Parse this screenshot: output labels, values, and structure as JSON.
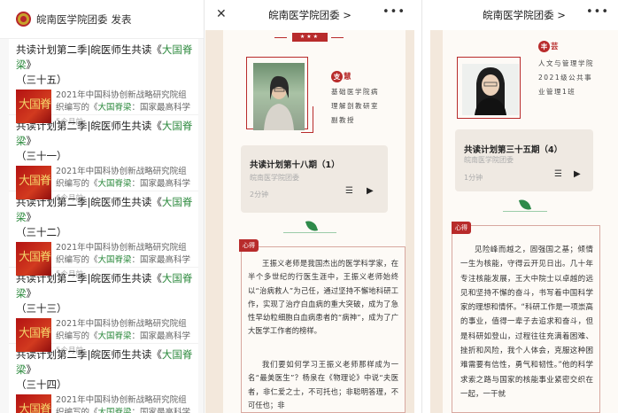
{
  "list": {
    "account": "皖南医学院团委",
    "publish": "发表",
    "items": [
      {
        "title_pre": "共读计划第二季|皖医师生共读《",
        "title_book": "大国脊梁",
        "title_post": "》",
        "title2": "（三十五）",
        "desc_pre": "2021年中国科协创新战略研究院组织编写的《",
        "desc_book": "大国脊梁",
        "desc_post": "：国家最高科学技术奖获...",
        "time": "5个月前",
        "thumb": "大国脊"
      },
      {
        "title_pre": "共读计划第二季|皖医师生共读《",
        "title_book": "大国脊梁",
        "title_post": "》",
        "title2": "（三十一）",
        "desc_pre": "2021年中国科协创新战略研究院组织编写的《",
        "desc_book": "大国脊梁",
        "desc_post": "：国家最高科学技术奖获...",
        "time": "6个月前",
        "thumb": "大国脊"
      },
      {
        "title_pre": "共读计划第二季|皖医师生共读《",
        "title_book": "大国脊梁",
        "title_post": "》",
        "title2": "（三十二）",
        "desc_pre": "2021年中国科协创新战略研究院组织编写的《",
        "desc_book": "大国脊梁",
        "desc_post": "：国家最高科学技术奖获...",
        "time": "5个月前",
        "thumb": "大国脊"
      },
      {
        "title_pre": "共读计划第二季|皖医师生共读《",
        "title_book": "大国脊梁",
        "title_post": "》",
        "title2": "（三十三）",
        "desc_pre": "2021年中国科协创新战略研究院组织编写的《",
        "desc_book": "大国脊梁",
        "desc_post": "：国家最高科学技术奖获...",
        "time": "5个月前",
        "thumb": "大国脊"
      },
      {
        "title_pre": "共读计划第二季|皖医师生共读《",
        "title_book": "大国脊梁",
        "title_post": "》",
        "title2": "（三十四）",
        "desc_pre": "2021年中国科协创新战略研究院组织编写的《",
        "desc_book": "大国脊梁",
        "desc_post": "：国家最高科学技术奖获...",
        "time": "5个月前",
        "thumb": "大国脊"
      }
    ]
  },
  "article1": {
    "topbar_title": "皖南医学院团委",
    "chevron": ">",
    "close": "✕",
    "more": "•••",
    "stars": "★★★",
    "name_c1": "支",
    "name_c2": "慧",
    "profile": "基础医学院病理解剖教研室副教授",
    "audio_title": "共读计划第十八期（1）",
    "audio_source": "皖南医学院团委",
    "audio_duration": "2分钟",
    "tag": "心得",
    "body": "王振义老师是我国杰出的医学科学家，在半个多世纪的行医生涯中，王振义老师始终以“治病救人”为己任，通过坚持不懈地科研工作，实现了治疗白血病的重大突破，成为了急性早幼粒细胞白血病患者的“病神”，成为了广大医学工作者的榜样。",
    "body2": "我们要如何学习王振义老师那样成为一名“最美医生”？杨泉在《物理论》中说“夫医者，非仁爱之士，不可托也；非聪明答理，不可任也；非"
  },
  "article2": {
    "topbar_title": "皖南医学院团委",
    "chevron": ">",
    "more": "•••",
    "name_c1": "丰",
    "name_c2": "芸",
    "profile": "人文与管理学院2021级公共事业管理1班",
    "audio_title": "共读计划第三十五期（4）",
    "audio_source": "皖南医学院团委",
    "audio_duration": "1分钟",
    "tag": "心得",
    "body": "见险峰而越之，固强国之基；倾情一生为核能，守得云开见日出。几十年专注核能发展，王大中院士以卓越的远见和坚持不懈的奋斗，书写着中国科学家的理想和情怀。“科研工作是一项崇高的事业，值得一辈子去追求和奋斗，但是科研如登山，过程往往充满着困难、挫折和风险，我个人体会，克服这种困难需要有信性，勇气和韧性。”他的科学求索之路与国家的核能事业紧密交织在一起，一干就"
  },
  "icons": {
    "list": "list-icon",
    "play": "play-icon",
    "leaf": "leaf-icon",
    "close": "close-icon",
    "more": "more-icon"
  }
}
